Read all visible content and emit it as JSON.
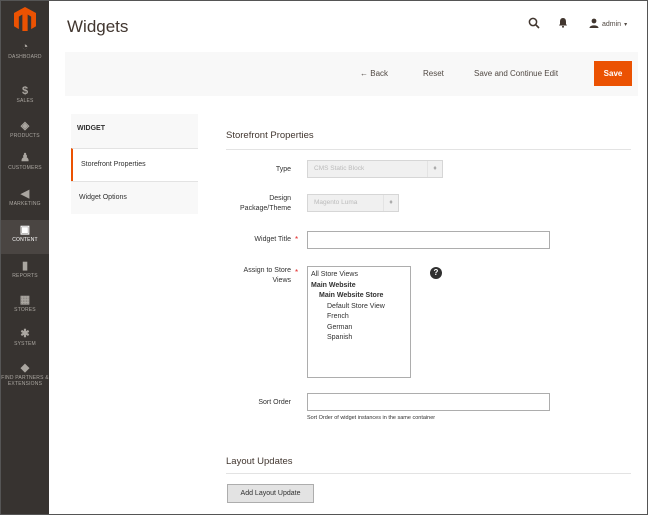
{
  "sidebar": {
    "items": [
      {
        "icon": "dashboard-icon",
        "glyph": "◔",
        "label": "DASHBOARD"
      },
      {
        "icon": "sales-icon",
        "glyph": "$",
        "label": "SALES"
      },
      {
        "icon": "products-icon",
        "glyph": "◈",
        "label": "PRODUCTS"
      },
      {
        "icon": "customers-icon",
        "glyph": "♟",
        "label": "CUSTOMERS"
      },
      {
        "icon": "marketing-icon",
        "glyph": "◀",
        "label": "MARKETING"
      },
      {
        "icon": "content-icon",
        "glyph": "▣",
        "label": "CONTENT"
      },
      {
        "icon": "reports-icon",
        "glyph": "▮",
        "label": "REPORTS"
      },
      {
        "icon": "stores-icon",
        "glyph": "▦",
        "label": "STORES"
      },
      {
        "icon": "system-icon",
        "glyph": "✱",
        "label": "SYSTEM"
      },
      {
        "icon": "partners-icon",
        "glyph": "◆",
        "label": "FIND PARTNERS & EXTENSIONS"
      }
    ]
  },
  "header": {
    "title": "Widgets",
    "user": "admin"
  },
  "actions": {
    "back": "Back",
    "reset": "Reset",
    "save_continue": "Save and Continue Edit",
    "save": "Save"
  },
  "tabs": {
    "heading": "WIDGET",
    "items": [
      "Storefront Properties",
      "Widget Options"
    ]
  },
  "form": {
    "section_title": "Storefront Properties",
    "type_label": "Type",
    "type_value": "CMS Static Block",
    "design_label_1": "Design",
    "design_label_2": "Package/Theme",
    "design_value": "Magento Luma",
    "title_label": "Widget Title",
    "title_value": "",
    "assign_label_1": "Assign to Store",
    "assign_label_2": "Views",
    "store_views": [
      {
        "text": "All Store Views",
        "level": 0,
        "group": false
      },
      {
        "text": "Main Website",
        "level": 0,
        "group": true
      },
      {
        "text": "Main Website Store",
        "level": 1,
        "group": true
      },
      {
        "text": "Default Store View",
        "level": 2,
        "group": false
      },
      {
        "text": "French",
        "level": 2,
        "group": false
      },
      {
        "text": "German",
        "level": 2,
        "group": false
      },
      {
        "text": "Spanish",
        "level": 2,
        "group": false
      }
    ],
    "sort_label": "Sort Order",
    "sort_value": "",
    "sort_note": "Sort Order of widget instances in the same container",
    "layout_title": "Layout Updates",
    "add_layout_button": "Add Layout Update"
  },
  "colors": {
    "accent": "#eb5202",
    "sidebar": "#373330"
  }
}
